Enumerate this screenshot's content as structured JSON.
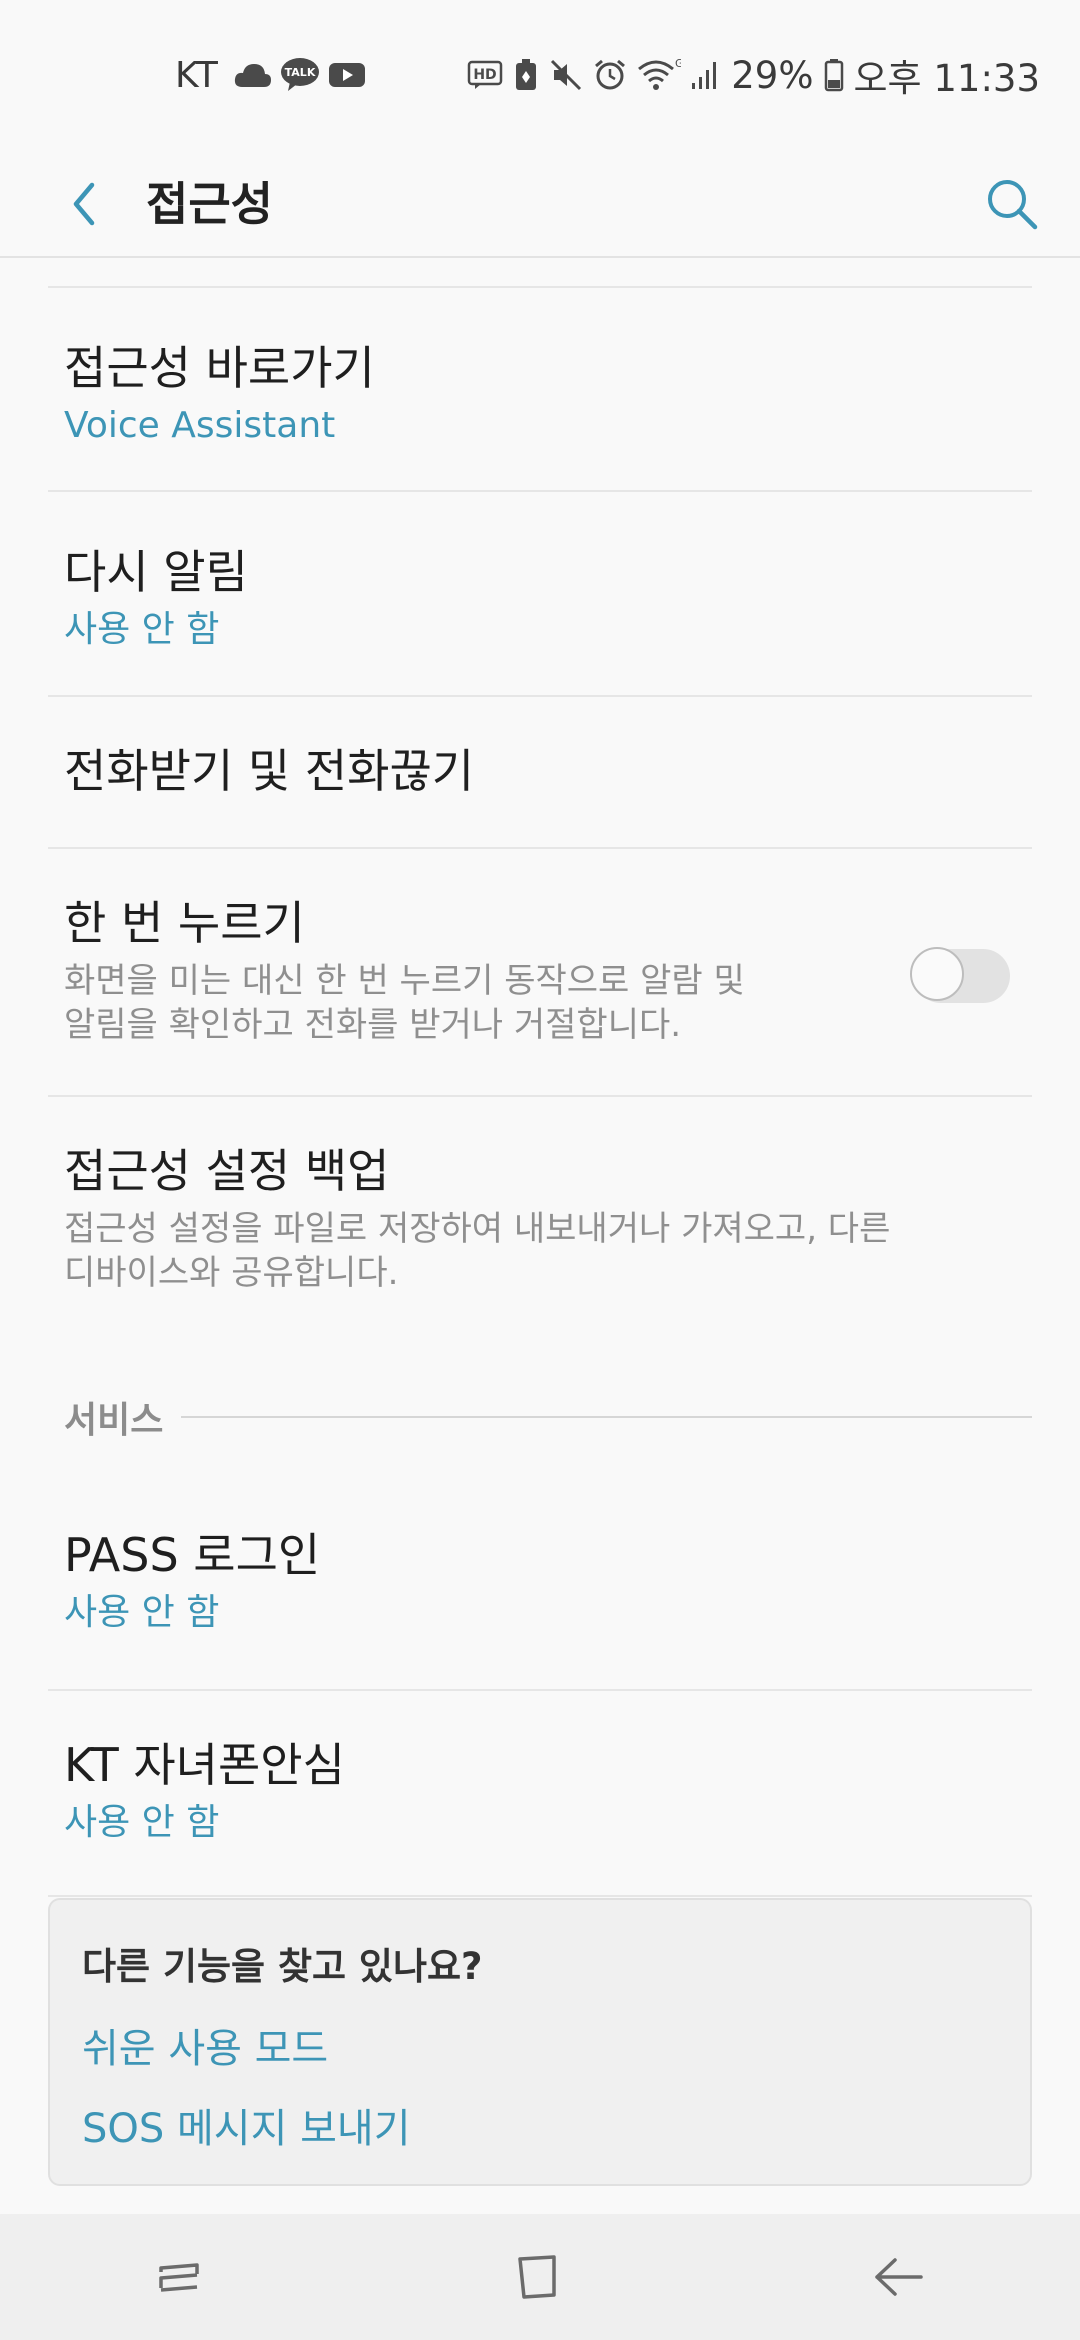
{
  "status_bar": {
    "carrier": "KT",
    "battery_percent": "29%",
    "time": "오후 11:33",
    "left_icons": [
      "cloud-icon",
      "kakaotalk-icon",
      "youtube-icon"
    ],
    "right_icons": [
      "hd-voice-icon",
      "battery-saver-icon",
      "mute-icon",
      "alarm-icon",
      "wifi-icon",
      "signal-icon",
      "battery-icon"
    ],
    "talk_label": "TALK",
    "hd_label": "HD",
    "wifi_label": "G"
  },
  "app_bar": {
    "title": "접근성"
  },
  "items": [
    {
      "title": "접근성 바로가기",
      "subtitle": "Voice Assistant"
    },
    {
      "title": "다시 알림",
      "subtitle": "사용 안 함"
    },
    {
      "title": "전화받기 및 전화끊기"
    },
    {
      "title": "한 번 누르기",
      "description_line1": "화면을 미는 대신 한 번 누르기 동작으로 알람 및",
      "description_line2": "알림을 확인하고 전화를 받거나 거절합니다.",
      "toggle_on": false
    },
    {
      "title": "접근성 설정 백업",
      "description_line1": "접근성 설정을 파일로 저장하여 내보내거나 가져오고, 다른",
      "description_line2": "디바이스와 공유합니다."
    }
  ],
  "section": {
    "label": "서비스"
  },
  "service_items": [
    {
      "title": "PASS 로그인",
      "subtitle": "사용 안 함"
    },
    {
      "title": "KT 자녀폰안심",
      "subtitle": "사용 안 함"
    }
  ],
  "suggest": {
    "title": "다른 기능을 찾고 있나요?",
    "links": [
      "쉬운 사용 모드",
      "SOS 메시지 보내기"
    ]
  },
  "nav_bar": {
    "buttons": [
      "recents-icon",
      "home-icon",
      "back-icon"
    ]
  },
  "colors": {
    "accent": "#3d95b6",
    "background": "#f9f9f9"
  }
}
